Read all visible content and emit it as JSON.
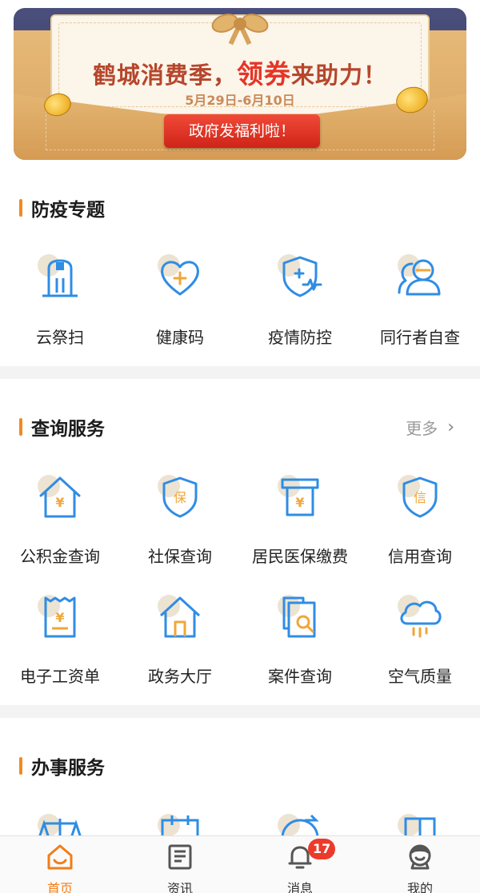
{
  "banner": {
    "headline_part1": "鹤城消费季，",
    "headline_big": "领券",
    "headline_part2": "来助力！",
    "dates": "5月29日-6月10日",
    "button_label": "政府发福利啦！"
  },
  "sections": {
    "epidemic": {
      "title": "防疫专题",
      "items": [
        {
          "label": "云祭扫",
          "icon": "memorial-icon"
        },
        {
          "label": "健康码",
          "icon": "heart-plus-icon"
        },
        {
          "label": "疫情防控",
          "icon": "shield-medical-icon"
        },
        {
          "label": "同行者自查",
          "icon": "people-icon"
        }
      ]
    },
    "query": {
      "title": "查询服务",
      "more_label": "更多",
      "items": [
        {
          "label": "公积金查询",
          "icon": "house-yuan-icon"
        },
        {
          "label": "社保查询",
          "icon": "shield-bao-icon"
        },
        {
          "label": "居民医保缴费",
          "icon": "atm-yuan-icon"
        },
        {
          "label": "信用查询",
          "icon": "shield-xin-icon"
        },
        {
          "label": "电子工资单",
          "icon": "receipt-yuan-icon"
        },
        {
          "label": "政务大厅",
          "icon": "hall-icon"
        },
        {
          "label": "案件查询",
          "icon": "document-search-icon"
        },
        {
          "label": "空气质量",
          "icon": "cloud-rain-icon"
        }
      ]
    },
    "affairs": {
      "title": "办事服务"
    }
  },
  "nav": {
    "items": [
      {
        "label": "首页",
        "icon": "home-icon",
        "active": true
      },
      {
        "label": "资讯",
        "icon": "news-icon"
      },
      {
        "label": "消息",
        "icon": "bell-icon"
      },
      {
        "label": "我的",
        "icon": "user-icon"
      }
    ],
    "message_badge": "17"
  },
  "colors": {
    "accent": "#f08a24",
    "icon_blue": "#2f8de4",
    "badge_red": "#ec3b2b",
    "nav_active": "#f07e1a"
  }
}
